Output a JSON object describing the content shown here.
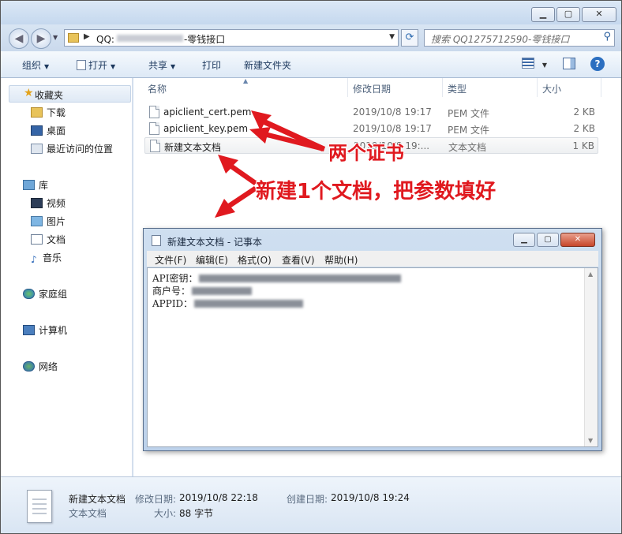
{
  "explorer": {
    "address": {
      "prefix": "QQ:",
      "suffix": "-零钱接口"
    },
    "search_placeholder": "搜索 QQ1275712590-零钱接口",
    "toolbar": {
      "organize": "组织",
      "open": "打开",
      "share": "共享",
      "print": "打印",
      "new_folder": "新建文件夹"
    },
    "sidebar": {
      "favorites": "收藏夹",
      "downloads": "下载",
      "desktop": "桌面",
      "recent": "最近访问的位置",
      "libraries": "库",
      "videos": "视频",
      "pictures": "图片",
      "documents": "文档",
      "music": "音乐",
      "homegroup": "家庭组",
      "computer": "计算机",
      "network": "网络"
    },
    "columns": {
      "name": "名称",
      "date": "修改日期",
      "type": "类型",
      "size": "大小"
    },
    "files": [
      {
        "name": "apiclient_cert.pem",
        "date": "2019/10/8 19:17",
        "type": "PEM 文件",
        "size": "2 KB"
      },
      {
        "name": "apiclient_key.pem",
        "date": "2019/10/8 19:17",
        "type": "PEM 文件",
        "size": "2 KB"
      },
      {
        "name": "新建文本文档",
        "date": "2019/10/8 19:...",
        "type": "文本文档",
        "size": "1 KB"
      }
    ],
    "status": {
      "filename": "新建文本文档",
      "modified_label": "修改日期:",
      "modified_value": "2019/10/8 22:18",
      "created_label": "创建日期:",
      "created_value": "2019/10/8 19:24",
      "filetype": "文本文档",
      "size_label": "大小:",
      "size_value": "88 字节"
    }
  },
  "annotations": {
    "two_certs": "两个证书",
    "new_doc": "新建1个文档，把参数填好",
    "color": "#e0191f"
  },
  "notepad": {
    "title": "新建文本文档 - 记事本",
    "menu": {
      "file": "文件(F)",
      "edit": "编辑(E)",
      "format": "格式(O)",
      "view": "查看(V)",
      "help": "帮助(H)"
    },
    "lines": {
      "api_key_label": "API密钥：",
      "merchant_label": "商户号：",
      "appid_label": "APPID："
    }
  }
}
